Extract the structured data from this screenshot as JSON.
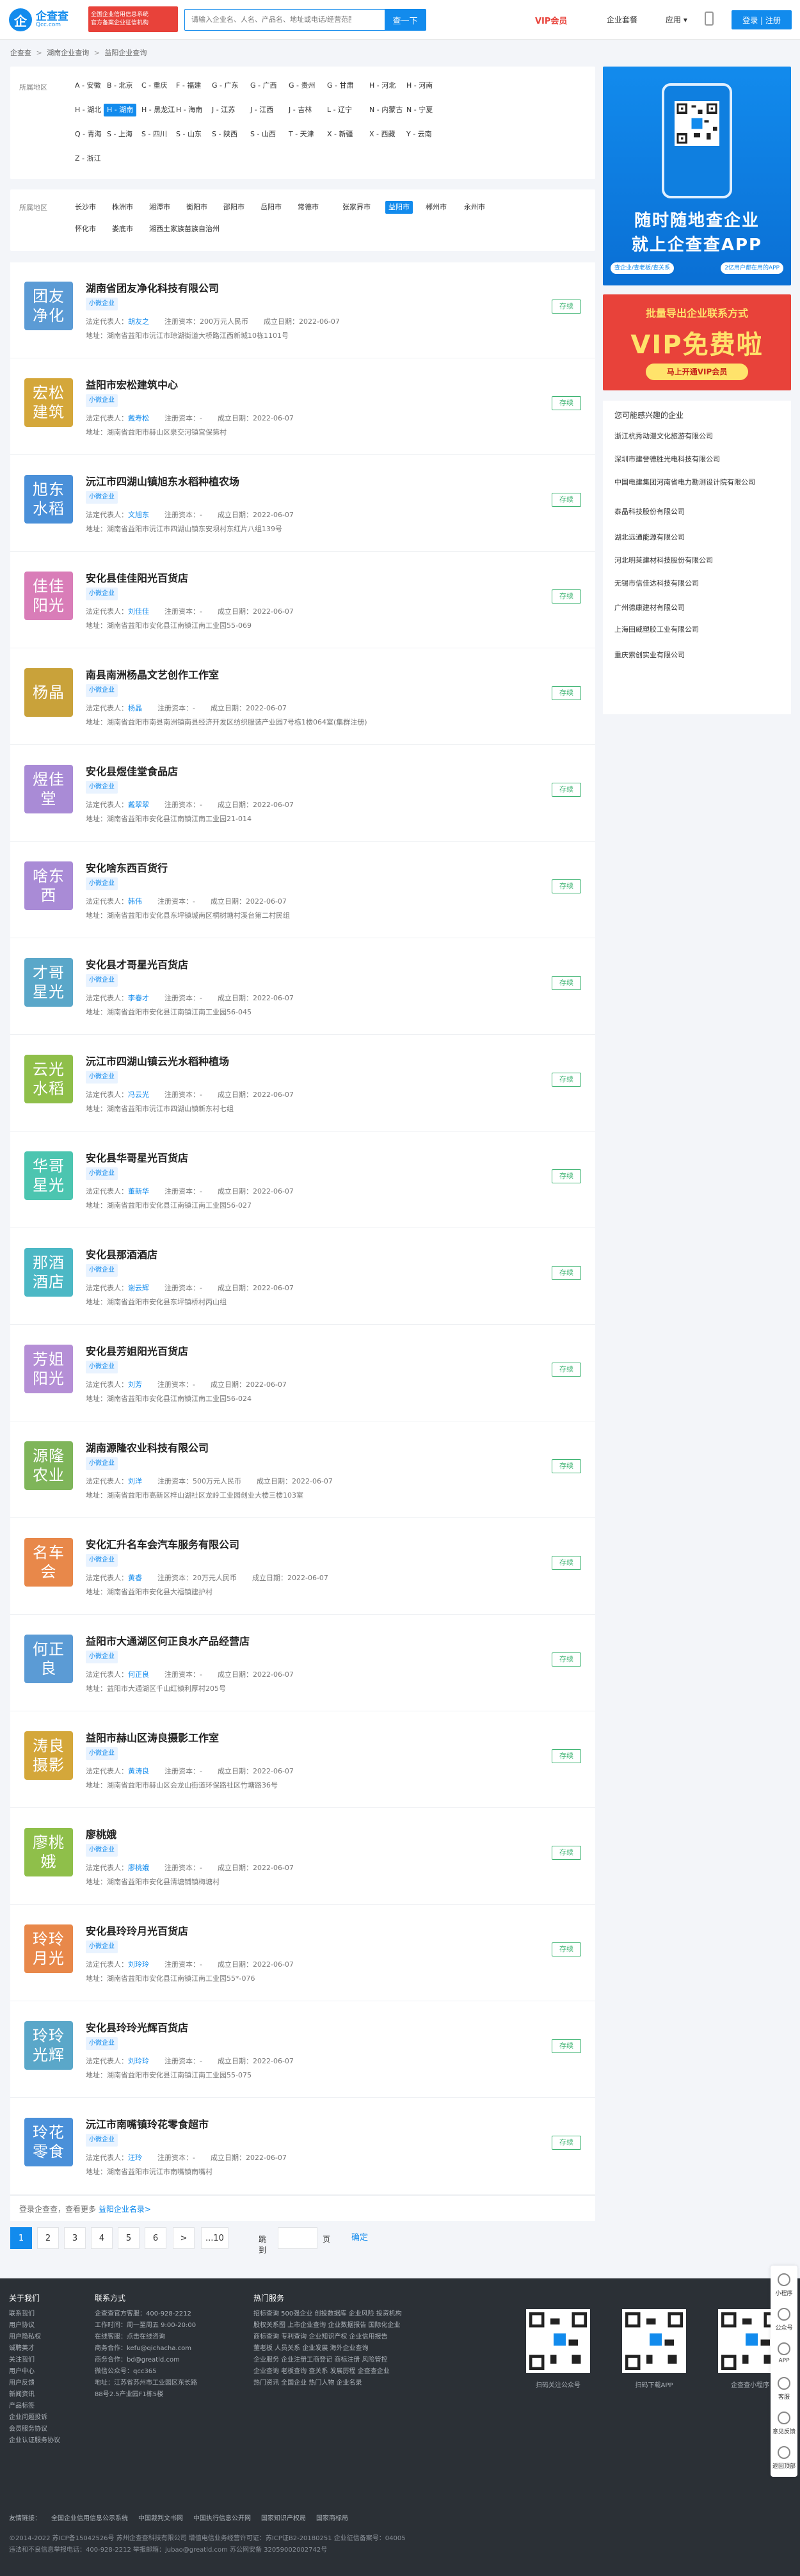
{
  "header": {
    "logo_mark": "企",
    "logo_title": "企查查",
    "logo_sub": "Qcc.com",
    "badge_line1": "全国企业信用信息系统",
    "badge_line2": "官方备案企业征信机构",
    "search_placeholder": "请输入企业名、人名、产品名、地址或电话/经营范围",
    "search_button": "查一下",
    "vip_label": "VIP会员",
    "nav_report": "企业套餐",
    "nav_apps": "应用 ▾",
    "login_label": "登录 | 注册"
  },
  "breadcrumb": {
    "home": "企查查",
    "sep": ">",
    "level1": "湖南企业查询",
    "level2": "益阳企业查询"
  },
  "province_filter": {
    "label": "所属地区",
    "items": [
      "A - 安徽",
      "B - 北京",
      "C - 重庆",
      "F - 福建",
      "G - 广东",
      "G - 广西",
      "G - 贵州",
      "G - 甘肃",
      "H - 河北",
      "H - 河南",
      "H - 湖北",
      "H - 湖南",
      "H - 黑龙江",
      "H - 海南",
      "J - 江苏",
      "J - 江西",
      "J - 吉林",
      "L - 辽宁",
      "N - 内蒙古",
      "N - 宁夏",
      "Q - 青海",
      "S - 上海",
      "S - 四川",
      "S - 山东",
      "S - 陕西",
      "S - 山西",
      "T - 天津",
      "X - 新疆",
      "X - 西藏",
      "Y - 云南",
      "Z - 浙江"
    ],
    "active": "H - 湖南"
  },
  "city_filter": {
    "label": "所属地区",
    "items": [
      "长沙市",
      "株洲市",
      "湘潭市",
      "衡阳市",
      "邵阳市",
      "岳阳市",
      "常德市",
      "张家界市",
      "益阳市",
      "郴州市",
      "永州市",
      "怀化市",
      "娄底市",
      "湘西土家族苗族自治州"
    ],
    "active": "益阳市"
  },
  "companies": [
    {
      "avatar": "团友净化",
      "color": "#5b9bd5",
      "name": "湖南省团友净化科技有限公司",
      "tag": "小微企业",
      "rep": "胡友之",
      "capital": "200万元人民币",
      "date": "2022-06-07",
      "address": "湖南省益阳市沅江市琼湖街道大桥路江西新城10栋1101号"
    },
    {
      "avatar": "宏松建筑",
      "color": "#d4a73a",
      "name": "益阳市宏松建筑中心",
      "tag": "小微企业",
      "rep": "戴寿松",
      "capital": "-",
      "date": "2022-06-07",
      "address": "湖南省益阳市赫山区泉交河镇宫保第村"
    },
    {
      "avatar": "旭东水稻",
      "color": "#4a90d9",
      "name": "沅江市四湖山镇旭东水稻种植农场",
      "tag": "小微企业",
      "rep": "文旭东",
      "capital": "-",
      "date": "2022-06-07",
      "address": "湖南省益阳市沅江市四湖山镇东安坝村东红片八组139号"
    },
    {
      "avatar": "佳佳阳光",
      "color": "#d97db8",
      "name": "安化县佳佳阳光百货店",
      "tag": "小微企业",
      "rep": "刘佳佳",
      "capital": "-",
      "date": "2022-06-07",
      "address": "湖南省益阳市安化县江南镇江南工业园55-069"
    },
    {
      "avatar": "杨晶",
      "color": "#c9a23a",
      "name": "南县南洲杨晶文艺创作工作室",
      "tag": "小微企业",
      "rep": "杨晶",
      "capital": "-",
      "date": "2022-06-07",
      "address": "湖南省益阳市南县南洲镇南县经济开发区纺织服装产业园7号栋1楼064室(集群注册)"
    },
    {
      "avatar": "煜佳堂",
      "color": "#a98bd6",
      "name": "安化县煜佳堂食品店",
      "tag": "小微企业",
      "rep": "戴翠翠",
      "capital": "-",
      "date": "2022-06-07",
      "address": "湖南省益阳市安化县江南镇江南工业园21-014"
    },
    {
      "avatar": "啥东西",
      "color": "#a98bd6",
      "name": "安化啥东西百货行",
      "tag": "小微企业",
      "rep": "韩伟",
      "capital": "-",
      "date": "2022-06-07",
      "address": "湖南省益阳市安化县东坪镇城南区桐树塘村溪台第二村民组"
    },
    {
      "avatar": "才哥星光",
      "color": "#5aa7c9",
      "name": "安化县才哥星光百货店",
      "tag": "小微企业",
      "rep": "李春才",
      "capital": "-",
      "date": "2022-06-07",
      "address": "湖南省益阳市安化县江南镇江南工业园56-045"
    },
    {
      "avatar": "云光水稻",
      "color": "#8fbf4a",
      "name": "沅江市四湖山镇云光水稻种植场",
      "tag": "小微企业",
      "rep": "冯云光",
      "capital": "-",
      "date": "2022-06-07",
      "address": "湖南省益阳市沅江市四湖山镇新东村七组"
    },
    {
      "avatar": "华哥星光",
      "color": "#4cc5b0",
      "name": "安化县华哥星光百货店",
      "tag": "小微企业",
      "rep": "董新华",
      "capital": "-",
      "date": "2022-06-07",
      "address": "湖南省益阳市安化县江南镇江南工业园56-027"
    },
    {
      "avatar": "那酒酒店",
      "color": "#4cb8c5",
      "name": "安化县那酒酒店",
      "tag": "小微企业",
      "rep": "谢云辉",
      "capital": "-",
      "date": "2022-06-07",
      "address": "湖南省益阳市安化县东坪镇桥村丙山组"
    },
    {
      "avatar": "芳姐阳光",
      "color": "#b58fd6",
      "name": "安化县芳姐阳光百货店",
      "tag": "小微企业",
      "rep": "刘芳",
      "capital": "-",
      "date": "2022-06-07",
      "address": "湖南省益阳市安化县江南镇江南工业园56-024"
    },
    {
      "avatar": "源隆农业",
      "color": "#7fb55a",
      "name": "湖南源隆农业科技有限公司",
      "tag": "小微企业",
      "rep": "刘洋",
      "capital": "500万元人民币",
      "date": "2022-06-07",
      "address": "湖南省益阳市高新区梓山湖社区龙岭工业园创业大楼三楼103室"
    },
    {
      "avatar": "名车会",
      "color": "#e8884a",
      "name": "安化汇升名车会汽车服务有限公司",
      "tag": "小微企业",
      "rep": "黄睿",
      "capital": "20万元人民币",
      "date": "2022-06-07",
      "address": "湖南省益阳市安化县大福镇建护村"
    },
    {
      "avatar": "何正良",
      "color": "#5b9bd5",
      "name": "益阳市大通湖区何正良水产品经营店",
      "tag": "小微企业",
      "rep": "何正良",
      "capital": "-",
      "date": "2022-06-07",
      "address": "益阳市大通湖区千山红镇利厚村205号"
    },
    {
      "avatar": "涛良摄影",
      "color": "#d4a73a",
      "name": "益阳市赫山区涛良摄影工作室",
      "tag": "小微企业",
      "rep": "黄涛良",
      "capital": "-",
      "date": "2022-06-07",
      "address": "湖南省益阳市赫山区会龙山街道环保路社区竹塘路36号"
    },
    {
      "avatar": "廖桃娥",
      "color": "#8fbf4a",
      "name": "廖桃娥",
      "tag": "小微企业",
      "rep": "廖桃娥",
      "capital": "-",
      "date": "2022-06-07",
      "address": "湖南省益阳市安化县清塘铺镇梅塘村"
    },
    {
      "avatar": "玲玲月光",
      "color": "#e8884a",
      "name": "安化县玲玲月光百货店",
      "tag": "小微企业",
      "rep": "刘玲玲",
      "capital": "-",
      "date": "2022-06-07",
      "address": "湖南省益阳市安化县江南镇江南工业园55*-076"
    },
    {
      "avatar": "玲玲光辉",
      "color": "#5aa7c9",
      "name": "安化县玲玲光辉百货店",
      "tag": "小微企业",
      "rep": "刘玲玲",
      "capital": "-",
      "date": "2022-06-07",
      "address": "湖南省益阳市安化县江南镇江南工业园55-075"
    },
    {
      "avatar": "玲花零食",
      "color": "#4a90d9",
      "name": "沅江市南嘴镇玲花零食超市",
      "tag": "小微企业",
      "rep": "汪玲",
      "capital": "-",
      "date": "2022-06-07",
      "address": "湖南省益阳市沅江市南嘴镇南嘴村"
    }
  ],
  "labels": {
    "rep": "法定代表人：",
    "capital": "注册资本：",
    "date": "成立日期：",
    "address": "地址：",
    "status": "存续"
  },
  "list_footer": {
    "text": "登录企查查，查看更多",
    "link": "益阳企业名录>"
  },
  "pagination": {
    "pages": [
      "1",
      "2",
      "3",
      "4",
      "5",
      "6",
      ">",
      "...10"
    ],
    "active": "1",
    "goto_label": "跳到",
    "page_unit": "页",
    "confirm": "确定"
  },
  "qr_card": {
    "title1": "随时随地查企业",
    "title2": "就上企查查APP",
    "pills": [
      "查企业/查老板/查关系",
      "2亿用户都在用的APP"
    ]
  },
  "vip_card": {
    "line1": "批量导出企业联系方式",
    "line2": "VIP免费啦",
    "button": "马上开通VIP会员"
  },
  "interest": {
    "title": "您可能感兴趣的企业",
    "items": [
      "浙江杭秀动漫文化旅游有限公司",
      "深圳市建誉德胜光电科技有限公司",
      "中国电建集团河南省电力勘测设计院有限公司",
      "泰晶科技股份有限公司",
      "湖北远通能源有限公司",
      "河北明莱建材科技股份有限公司",
      "无锡市信佳达科技有限公司",
      "广州德康建材有限公司",
      "上海田威塑胶工业有限公司",
      "重庆索创实业有限公司"
    ]
  },
  "footer": {
    "col1_title": "关于我们",
    "col1_items": [
      "联系我们",
      "用户协议",
      "用户隐私权",
      "诚聘英才",
      "关注我们",
      "用户中心",
      "用户反馈",
      "新闻资讯",
      "产品标签",
      "企业问题投诉",
      "会员服务协议",
      "企业认证服务协议"
    ],
    "col2_title": "联系方式",
    "col2_items": [
      "企查查官方客服：400-928-2212",
      "工作时间：周一至周五 9:00-20:00",
      "在线客服：点击在线咨询",
      "商务合作：kefu@qichacha.com",
      "商务合作：bd@greatld.com",
      "微信公众号：qcc365",
      "地址：江苏省苏州市工业园区东长路",
      "88号2.5产业园F1栋5楼"
    ],
    "col3_title": "热门服务",
    "col3_items": [
      "招标查询  500强企业  创投数据库  企业风险  投资机构",
      "股权关系图  上市企业查询  企业数据报告  国际化企业",
      "商标查询  专利查询  企业知识产权  企业信用报告",
      "董老板  人员关系  企业发展  海外企业查询",
      "企业服务  企业注册工商登记  商标注册  风险管控",
      "企业查询  老板查询  查关系  发展历程  企查查企业",
      "热门资讯  全国企业  热门人物  企业名录"
    ],
    "qr_labels": [
      "扫码关注公众号",
      "扫码下载APP",
      "企查查小程序"
    ],
    "friend_links": [
      "友情链接：",
      "全国企业信用信息公示系统",
      "中国裁判文书网",
      "中国执行信息公开网",
      "国家知识产权局",
      "国家商标局"
    ],
    "copyright_line1": "©2014-2022 苏ICP备15042526号 苏州企查查科技有限公司  增值电信业务经营许可证：苏ICP证B2-20180251  企业征信备案号：04005",
    "copyright_line2": "违法和不良信息举报电话：400-928-2212  举报邮箱：jubao@greatld.com  苏公网安备 32059002002742号"
  },
  "side_tools": [
    "小程序",
    "公众号",
    "APP",
    "客服",
    "意见反馈",
    "返回顶部"
  ]
}
